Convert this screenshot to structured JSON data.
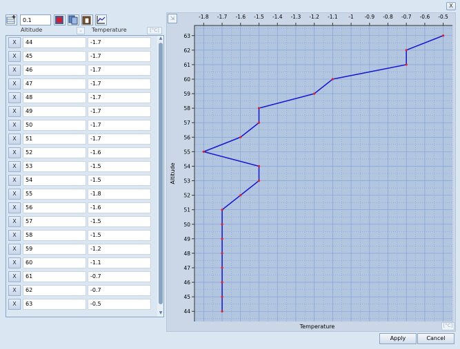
{
  "titlebar": {
    "close_label": "X"
  },
  "toolbar": {
    "step_value": "0.1"
  },
  "table": {
    "col_altitude": "Altitude",
    "col_temperature": "Temperature",
    "col_temp_unit": "[°C]",
    "delete_label": "X",
    "rows": [
      {
        "altitude": "44",
        "temperature": "-1.7"
      },
      {
        "altitude": "45",
        "temperature": "-1.7"
      },
      {
        "altitude": "46",
        "temperature": "-1.7"
      },
      {
        "altitude": "47",
        "temperature": "-1.7"
      },
      {
        "altitude": "48",
        "temperature": "-1.7"
      },
      {
        "altitude": "49",
        "temperature": "-1.7"
      },
      {
        "altitude": "50",
        "temperature": "-1.7"
      },
      {
        "altitude": "51",
        "temperature": "-1.7"
      },
      {
        "altitude": "52",
        "temperature": "-1.6"
      },
      {
        "altitude": "53",
        "temperature": "-1.5"
      },
      {
        "altitude": "54",
        "temperature": "-1.5"
      },
      {
        "altitude": "55",
        "temperature": "-1.8"
      },
      {
        "altitude": "56",
        "temperature": "-1.6"
      },
      {
        "altitude": "57",
        "temperature": "-1.5"
      },
      {
        "altitude": "58",
        "temperature": "-1.5"
      },
      {
        "altitude": "59",
        "temperature": "-1.2"
      },
      {
        "altitude": "60",
        "temperature": "-1.1"
      },
      {
        "altitude": "61",
        "temperature": "-0.7"
      },
      {
        "altitude": "62",
        "temperature": "-0.7"
      },
      {
        "altitude": "63",
        "temperature": "-0.5"
      }
    ]
  },
  "chart_data": {
    "type": "line",
    "orientation": "vertical-profile",
    "xlabel": "Temperature",
    "ylabel": "Altitude",
    "x_unit": "[°C]",
    "xlim": [
      -1.85,
      -0.45
    ],
    "ylim": [
      43.3,
      63.7
    ],
    "x_ticks": [
      "-1.8",
      "-1.7",
      "-1.6",
      "-1.5",
      "-1.4",
      "-1.3",
      "-1.2",
      "-1.1",
      "-1",
      "-0.9",
      "-0.8",
      "-0.7",
      "-0.6",
      "-0.5"
    ],
    "y_ticks": [
      "44",
      "45",
      "46",
      "47",
      "48",
      "49",
      "50",
      "51",
      "52",
      "53",
      "54",
      "55",
      "56",
      "57",
      "58",
      "59",
      "60",
      "61",
      "62",
      "63"
    ],
    "x_tick_values": [
      -1.8,
      -1.7,
      -1.6,
      -1.5,
      -1.4,
      -1.3,
      -1.2,
      -1.1,
      -1.0,
      -0.9,
      -0.8,
      -0.7,
      -0.6,
      -0.5
    ],
    "y_tick_values": [
      44,
      45,
      46,
      47,
      48,
      49,
      50,
      51,
      52,
      53,
      54,
      55,
      56,
      57,
      58,
      59,
      60,
      61,
      62,
      63
    ],
    "line_color": "#1a1ad6",
    "point_color": "#e0202a",
    "grid": true,
    "grid_color": "#7f9fd9",
    "plot_bg": "#b3c6e0",
    "x_axis_position": "top",
    "points": [
      {
        "x": -1.7,
        "y": 44
      },
      {
        "x": -1.7,
        "y": 45
      },
      {
        "x": -1.7,
        "y": 46
      },
      {
        "x": -1.7,
        "y": 47
      },
      {
        "x": -1.7,
        "y": 48
      },
      {
        "x": -1.7,
        "y": 49
      },
      {
        "x": -1.7,
        "y": 50
      },
      {
        "x": -1.7,
        "y": 51
      },
      {
        "x": -1.6,
        "y": 52
      },
      {
        "x": -1.5,
        "y": 53
      },
      {
        "x": -1.5,
        "y": 54
      },
      {
        "x": -1.8,
        "y": 55
      },
      {
        "x": -1.6,
        "y": 56
      },
      {
        "x": -1.5,
        "y": 57
      },
      {
        "x": -1.5,
        "y": 58
      },
      {
        "x": -1.2,
        "y": 59
      },
      {
        "x": -1.1,
        "y": 60
      },
      {
        "x": -0.7,
        "y": 61
      },
      {
        "x": -0.7,
        "y": 62
      },
      {
        "x": -0.5,
        "y": 63
      }
    ]
  },
  "buttons": {
    "apply": "Apply",
    "cancel": "Cancel"
  },
  "icons": {
    "toolbar": [
      "add-row-icon",
      "color-grid-icon",
      "copy-icon",
      "paste-icon",
      "chart-icon"
    ],
    "corner": "collapse-icon"
  }
}
